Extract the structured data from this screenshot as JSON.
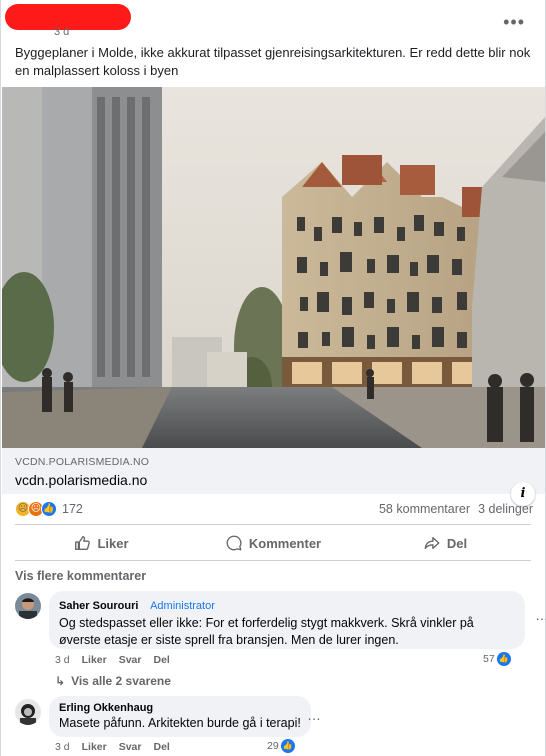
{
  "post": {
    "time": "3 d",
    "text": "Byggeplaner i Molde, ikke akkurat tilpasset gjenreisingsarkitekturen. Er redd dette blir nok en malplassert koloss i byen",
    "link_domain": "VCDN.POLARISMEDIA.NO",
    "link_title": "vcdn.polarismedia.no",
    "info_icon": "i"
  },
  "stats": {
    "reaction_count": "172",
    "comments": "58 kommentarer",
    "shares": "3 delinger",
    "reaction_icons": [
      "sad-emoji",
      "angry-emoji",
      "like"
    ]
  },
  "actions": {
    "like": "Liker",
    "comment": "Kommenter",
    "share": "Del"
  },
  "more_comments": "Vis flere kommentarer",
  "comments": [
    {
      "name": "Saher Sourouri",
      "role": "Administrator",
      "text": "Og stedspasset eller ikke: For et forferdelig stygt makkverk. Skrå vinkler på øverste etasje er siste sprell fra bransjen. Men de lurer ingen.",
      "time": "3 d",
      "like": "Liker",
      "reply": "Svar",
      "share": "Del",
      "likes": "57"
    },
    {
      "name": "Erling Okkenhaug",
      "text": "Masete påfunn. Arkitekten burde gå i terapi!",
      "time": "3 d",
      "like": "Liker",
      "reply": "Svar",
      "share": "Del",
      "likes": "29"
    }
  ],
  "replies_link": "Vis alle 2 svarene",
  "colors": {
    "accent": "#1877f2",
    "redaction": "#ff1a1a",
    "bubble": "#f0f2f5"
  }
}
